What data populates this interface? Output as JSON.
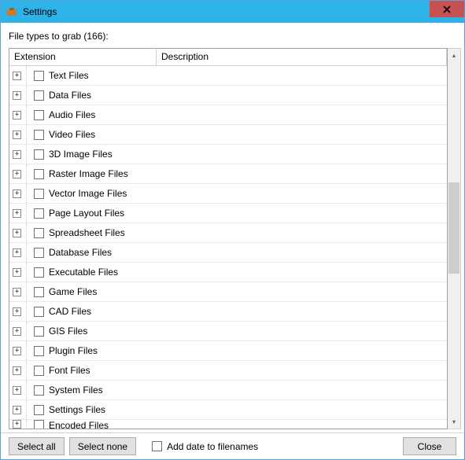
{
  "window": {
    "title": "Settings"
  },
  "body": {
    "label": "File types to grab (166):"
  },
  "grid": {
    "columns": {
      "extension": "Extension",
      "description": "Description"
    },
    "rows": [
      {
        "label": "Text Files"
      },
      {
        "label": "Data Files"
      },
      {
        "label": "Audio Files"
      },
      {
        "label": "Video Files"
      },
      {
        "label": "3D Image Files"
      },
      {
        "label": "Raster Image Files"
      },
      {
        "label": "Vector Image Files"
      },
      {
        "label": "Page Layout Files"
      },
      {
        "label": "Spreadsheet Files"
      },
      {
        "label": "Database Files"
      },
      {
        "label": "Executable Files"
      },
      {
        "label": "Game Files"
      },
      {
        "label": "CAD Files"
      },
      {
        "label": "GIS Files"
      },
      {
        "label": "Plugin Files"
      },
      {
        "label": "Font Files"
      },
      {
        "label": "System Files"
      },
      {
        "label": "Settings Files"
      },
      {
        "label": "Encoded Files"
      }
    ]
  },
  "footer": {
    "select_all": "Select all",
    "select_none": "Select none",
    "add_date": "Add date to filenames",
    "close": "Close"
  }
}
